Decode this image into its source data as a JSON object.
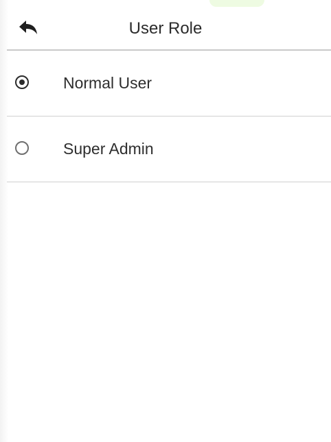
{
  "header": {
    "title": "User Role",
    "back_icon": "back-arrow-icon"
  },
  "options": [
    {
      "label": "Normal User",
      "selected": true
    },
    {
      "label": "Super Admin",
      "selected": false
    }
  ],
  "colors": {
    "text": "#2b2b2b",
    "divider": "#cfcfcf",
    "background": "#ffffff"
  }
}
